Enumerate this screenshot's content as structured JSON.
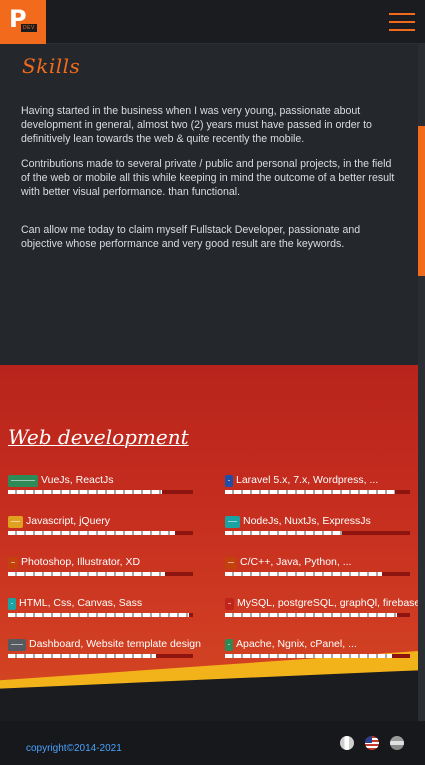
{
  "header": {
    "logo_letter": "P",
    "logo_tag": "DEV",
    "menu_icon": "hamburger-icon"
  },
  "skills_section": {
    "title": "Skills",
    "paragraphs": [
      "Having started in the business when I was very young, passionate about development in general, almost two (2) years must have passed in order to definitively lean towards the web & quite recently the mobile.",
      "Contributions made to several private / public and personal projects, in the field of the web or mobile all this while keeping in mind the outcome of a better result with better visual performance. than functional.",
      "Can allow me today to claim myself Fullstack Developer, passionate and objective whose performance and very good result are the keywords."
    ]
  },
  "web_section": {
    "title": "Web development",
    "skills": [
      {
        "label": "VueJs, ReactJs",
        "color": "#2e8b57",
        "level": 0.83
      },
      {
        "label": "Laravel 5.x, 7.x, Wordpress, ...",
        "color": "#1e4fa8",
        "level": 0.92
      },
      {
        "label": "Javascript, jQuery",
        "color": "#e0a020",
        "level": 0.9
      },
      {
        "label": "NodeJs, NuxtJs, ExpressJs",
        "color": "#1aa3a3",
        "level": 0.63
      },
      {
        "label": "Photoshop, Illustrator, XD",
        "color": "#c2410c",
        "level": 0.85
      },
      {
        "label": "C/C++, Java, Python, ...",
        "color": "#c2410c",
        "level": 0.85
      },
      {
        "label": "HTML, Css, Canvas, Sass",
        "color": "#1aa3a3",
        "level": 0.98
      },
      {
        "label": "MySQL, postgreSQL, graphQl, firebase",
        "color": "#c0241b",
        "level": 0.93
      },
      {
        "label": "Dashboard, Website template design",
        "color": "#555a60",
        "level": 0.8
      },
      {
        "label": "Apache, Ngnix, cPanel, ...",
        "color": "#2e8b57",
        "level": 0.9
      }
    ]
  },
  "footer": {
    "copyright": "copyright©2014-2021",
    "languages": [
      "fr",
      "en",
      "other"
    ]
  }
}
